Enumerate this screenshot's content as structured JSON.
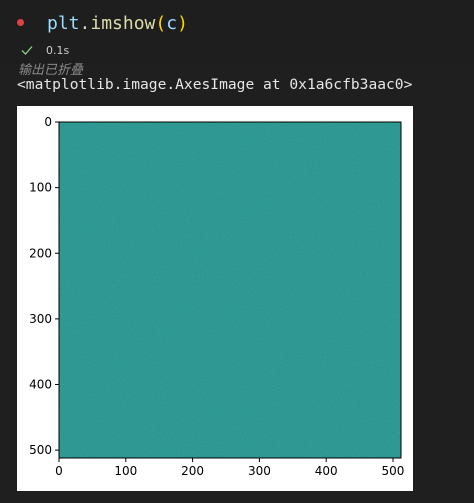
{
  "cell": {
    "code_tokens": [
      "plt",
      ".",
      "imshow",
      "(",
      "c",
      ")"
    ],
    "status_time": "0.1s",
    "output_collapsed_label": "输出已折叠",
    "output_repr": "<matplotlib.image.AxesImage at 0x1a6cfb3aac0>"
  },
  "colors": {
    "exec_dot": "#e04343",
    "image_fill": "#21918c",
    "check": "#89d185"
  },
  "chart_data": {
    "type": "heatmap",
    "title": "",
    "xlabel": "",
    "ylabel": "",
    "xlim": [
      0,
      512
    ],
    "ylim": [
      512,
      0
    ],
    "x_ticks": [
      0,
      100,
      200,
      300,
      400,
      500
    ],
    "y_ticks": [
      0,
      100,
      200,
      300,
      400,
      500
    ],
    "colormap": "viridis",
    "dominant_color": "#21918c",
    "grid": false
  }
}
